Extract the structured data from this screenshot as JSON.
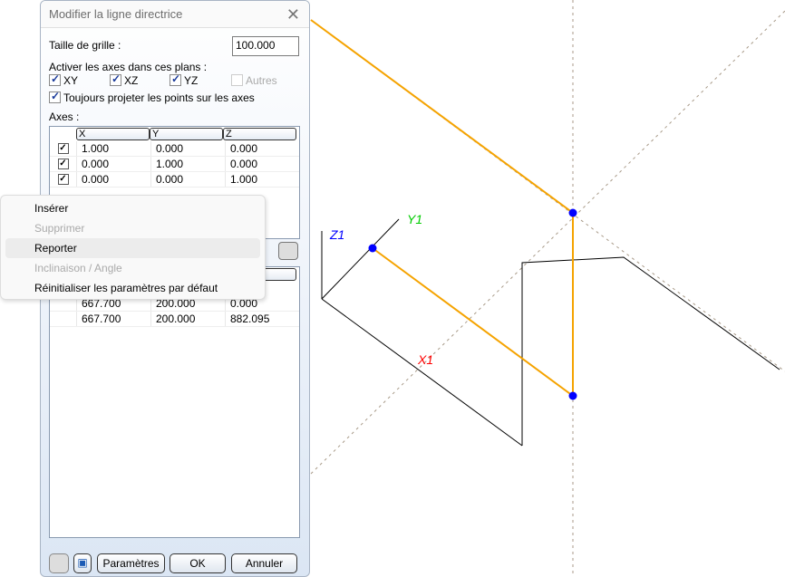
{
  "dialog": {
    "title": "Modifier la ligne directrice",
    "grid_size_label": "Taille de grille :",
    "grid_size_value": "100.000",
    "planes_label": "Activer les axes dans ces plans :",
    "planes": [
      {
        "label": "XY",
        "checked": true
      },
      {
        "label": "XZ",
        "checked": true
      },
      {
        "label": "YZ",
        "checked": true
      },
      {
        "label": "Autres",
        "checked": false,
        "disabled": true
      }
    ],
    "project_label": "Toujours projeter les points sur les axes",
    "axes_label": "Axes :",
    "axes_headers": [
      "X",
      "Y",
      "Z"
    ],
    "axes_rows": [
      [
        "1.000",
        "0.000",
        "0.000"
      ],
      [
        "0.000",
        "1.000",
        "0.000"
      ],
      [
        "0.000",
        "0.000",
        "1.000"
      ]
    ],
    "points_rows": [
      [
        "667.700",
        "200.000",
        "0.000"
      ],
      [
        "667.700",
        "200.000",
        "882.095"
      ]
    ],
    "buttons": {
      "params": "Paramètres",
      "ok": "OK",
      "cancel": "Annuler"
    }
  },
  "context_menu": [
    {
      "label": "Insérer",
      "disabled": false
    },
    {
      "label": "Supprimer",
      "disabled": true
    },
    {
      "label": "Reporter",
      "disabled": false,
      "highlighted": true
    },
    {
      "label": "Inclinaison / Angle",
      "disabled": true
    },
    {
      "label": "Réinitialiser les paramètres par défaut",
      "disabled": false
    }
  ],
  "viewport": {
    "labels": {
      "z": "Z1",
      "y": "Y1",
      "x": "X1"
    },
    "colors": {
      "path": "#f5a300",
      "point": "#0000ff",
      "z": "#0000ff",
      "y": "#00cc00",
      "x": "#ff0000"
    }
  }
}
